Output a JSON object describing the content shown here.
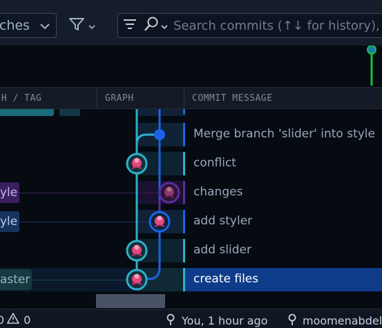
{
  "toolbar": {
    "branches_label": "ches",
    "search_placeholder": "Search commits (↑↓ for history), e.g."
  },
  "header": {
    "branch_tag": "H / TAG",
    "graph": "GRAPH",
    "commit_message": "COMMIT MESSAGE"
  },
  "tags": {
    "row3": "yle",
    "row4": "yle",
    "row7": "aster"
  },
  "commits": [
    {
      "message": "Merge branch 'slider' into style"
    },
    {
      "message": "conflict"
    },
    {
      "message": "changes"
    },
    {
      "message": "add styler"
    },
    {
      "message": "add slider"
    },
    {
      "message": "create files"
    }
  ],
  "status": {
    "errors": "0",
    "warnings": "0",
    "blame": "You, 1 hour ago",
    "author": "moomenabdel"
  },
  "colors": {
    "accent_blue": "#0e3b8a",
    "lane_teal": "#2fb0cc",
    "lane_blue": "#1c63e8",
    "lane_purple": "#5b2d9a",
    "minimap_green": "#17c23a"
  }
}
